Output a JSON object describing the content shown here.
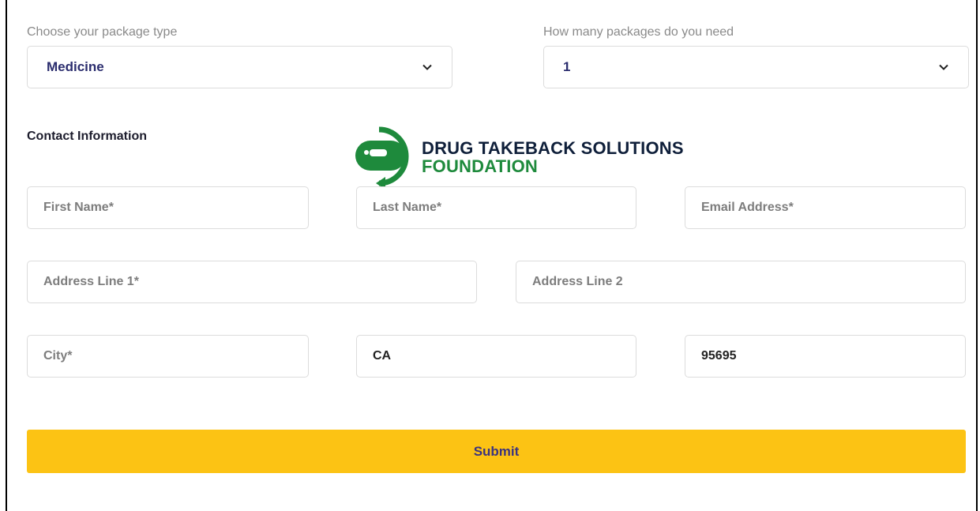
{
  "package_type": {
    "label": "Choose your package type",
    "selected": "Medicine"
  },
  "package_count": {
    "label": "How many packages do you need",
    "selected": "1"
  },
  "contact": {
    "title": "Contact Information",
    "first_name": {
      "placeholder": "First Name*",
      "value": ""
    },
    "last_name": {
      "placeholder": "Last Name*",
      "value": ""
    },
    "email": {
      "placeholder": "Email Address*",
      "value": ""
    },
    "address1": {
      "placeholder": "Address Line 1*",
      "value": ""
    },
    "address2": {
      "placeholder": "Address Line 2",
      "value": ""
    },
    "city": {
      "placeholder": "City*",
      "value": ""
    },
    "state": {
      "value": "CA"
    },
    "zip": {
      "value": "95695"
    }
  },
  "submit_label": "Submit",
  "logo": {
    "line1": "DRUG TAKEBACK SOLUTIONS",
    "line2": "FOUNDATION",
    "icon": "pill-return-icon"
  },
  "colors": {
    "accent": "#fcc314",
    "brand_green": "#1e8a3c",
    "brand_navy": "#0f1f3a",
    "select_text": "#2b2d6e"
  }
}
